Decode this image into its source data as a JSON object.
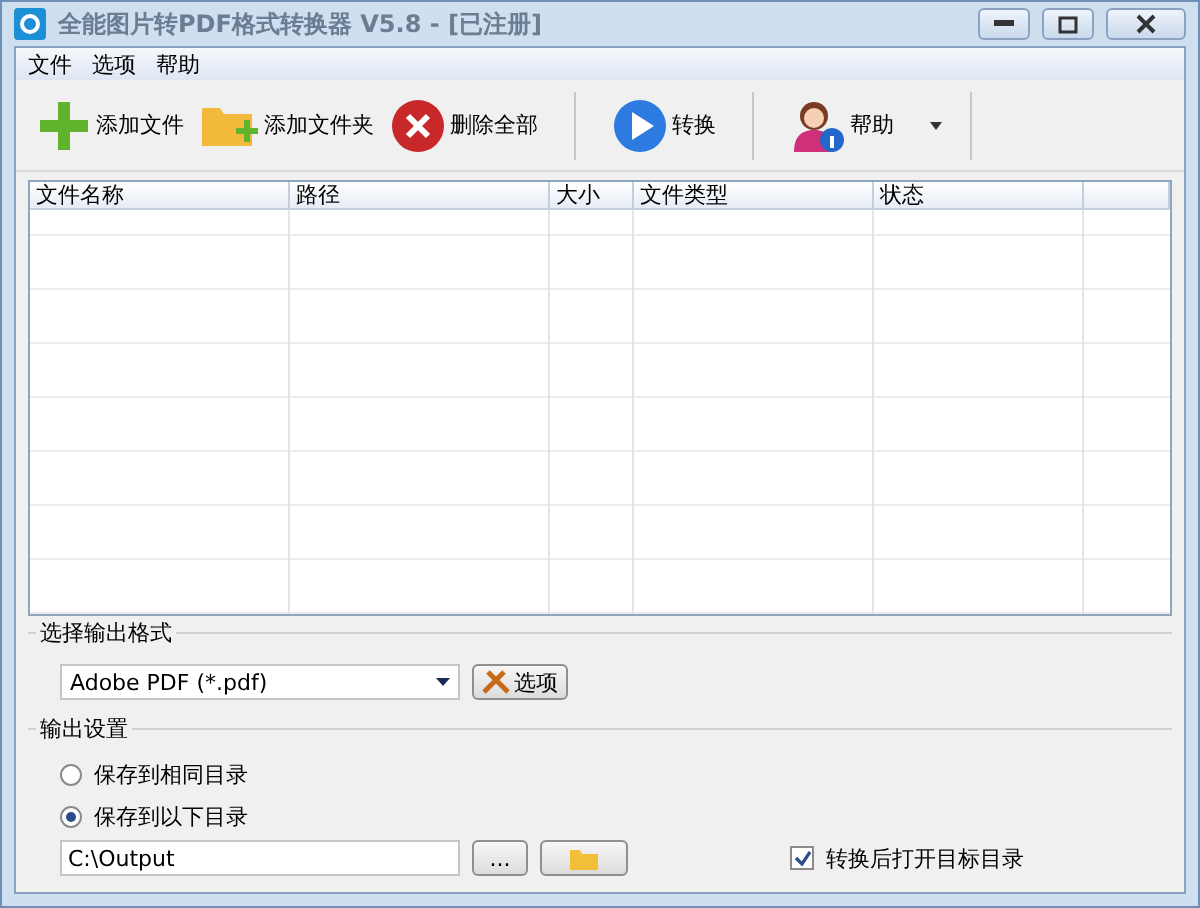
{
  "window": {
    "title": "全能图片转PDF格式转换器 V5.8 - [已注册]"
  },
  "menu": [
    "文件",
    "选项",
    "帮助"
  ],
  "toolbar": [
    {
      "kind": "add",
      "label": "添加文件"
    },
    {
      "kind": "folder",
      "label": "添加文件夹"
    },
    {
      "kind": "delete",
      "label": "删除全部"
    },
    {
      "kind": "convert",
      "label": "转换"
    },
    {
      "kind": "help",
      "label": "帮助"
    }
  ],
  "table": {
    "columns": [
      "文件名称",
      "路径",
      "大小",
      "文件类型",
      "状态"
    ]
  },
  "format_group": {
    "title": "选择输出格式",
    "format": "Adobe PDF (*.pdf)",
    "options_button": "选项"
  },
  "output_group": {
    "title": "输出设置",
    "radios": [
      {
        "label": "保存到相同目录",
        "selected": false
      },
      {
        "label": "保存到以下目录",
        "selected": true
      }
    ],
    "path": "C:\\Output",
    "browse_button": "...",
    "open_after": {
      "label": "转换后打开目标目录",
      "checked": true
    }
  }
}
